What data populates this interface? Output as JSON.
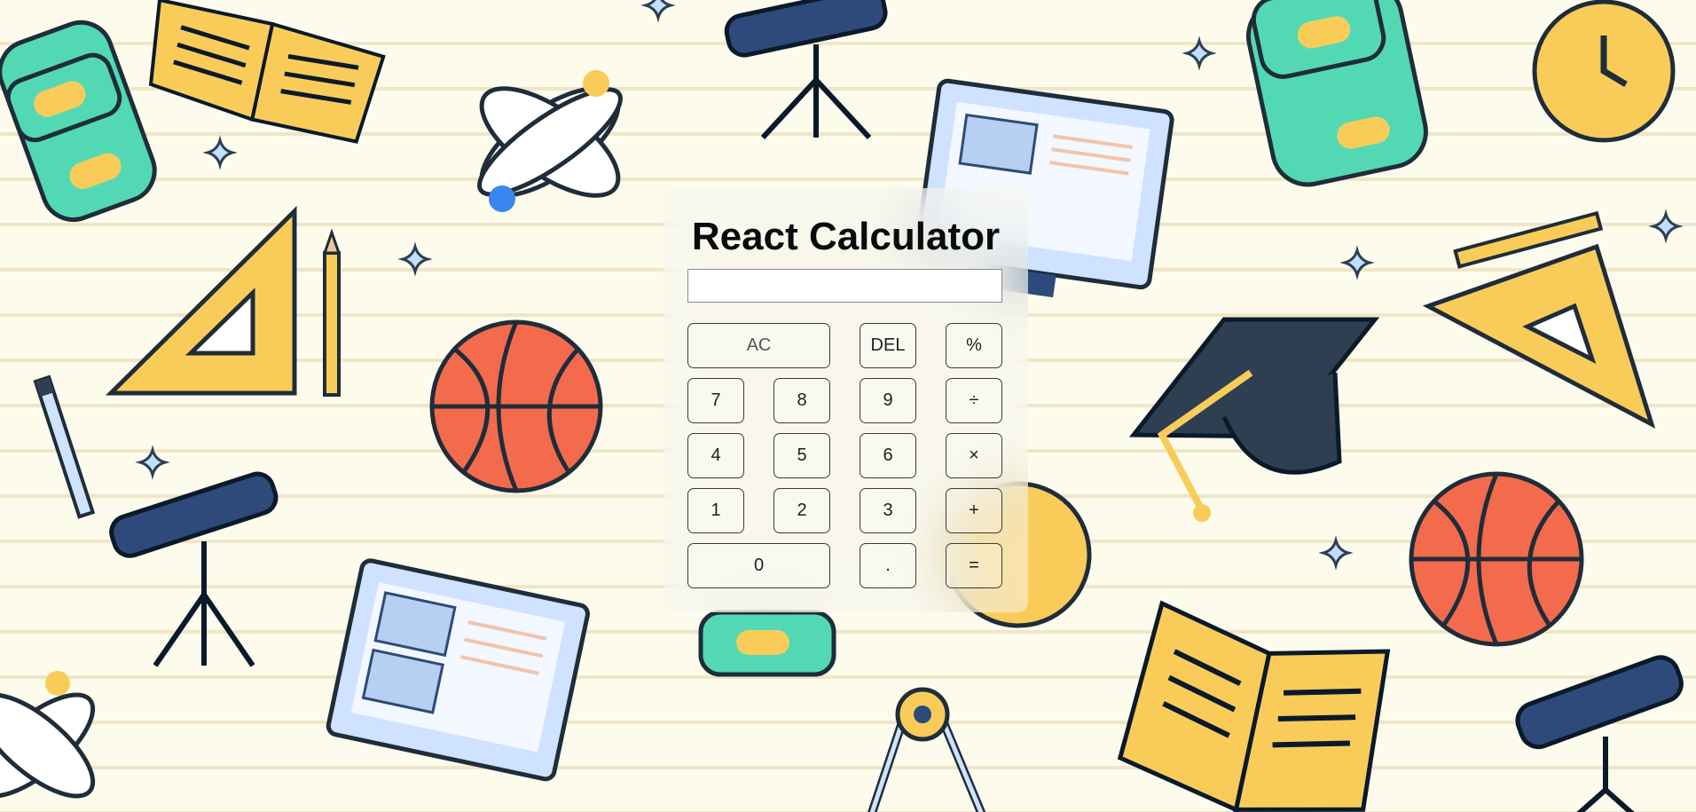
{
  "calculator": {
    "title": "React Calculator",
    "display_value": "",
    "keys": {
      "ac": "AC",
      "del": "DEL",
      "percent": "%",
      "seven": "7",
      "eight": "8",
      "nine": "9",
      "divide": "÷",
      "four": "4",
      "five": "5",
      "six": "6",
      "multiply": "×",
      "one": "1",
      "two": "2",
      "three": "3",
      "plus": "+",
      "zero": "0",
      "dot": ".",
      "equals": "="
    }
  },
  "background": {
    "illustrations": [
      "open-book-icon",
      "backpack-icon",
      "atom-icon",
      "telescope-icon",
      "set-square-icon",
      "pencil-icon",
      "basketball-icon",
      "monitor-icon",
      "graduation-cap-icon",
      "alarm-clock-icon",
      "compass-icon",
      "sparkle-icon"
    ],
    "colors": {
      "paper": "#fdfbec",
      "yellow": "#f9cc5a",
      "green": "#52d9b4",
      "navy": "#2d4a7a",
      "orange": "#f36b4c",
      "dark": "#2e3f52"
    }
  }
}
